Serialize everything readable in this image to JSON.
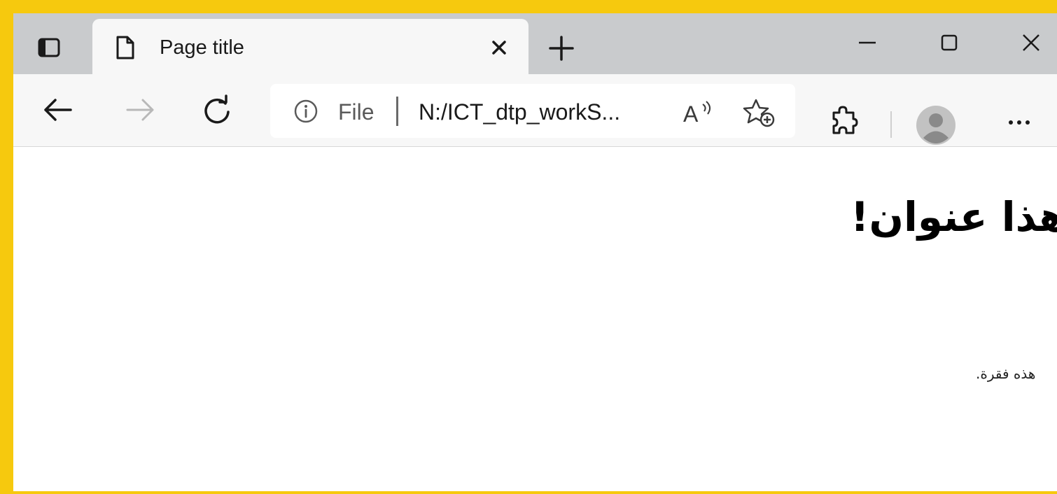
{
  "tab": {
    "title": "Page title"
  },
  "address_bar": {
    "site_label": "File",
    "url": "N:/ICT_dtp_workS..."
  },
  "page": {
    "heading": "هذا عنوان!",
    "paragraph": "هذه فقرة."
  },
  "icons": {
    "tab_actions": "tab-actions-icon",
    "favicon": "page-icon",
    "tab_close": "close-icon",
    "new_tab": "plus-icon",
    "minimize": "minimize-icon",
    "maximize": "maximize-icon",
    "close": "close-icon",
    "back": "arrow-left-icon",
    "forward": "arrow-right-icon",
    "refresh": "refresh-icon",
    "info": "info-icon",
    "read_aloud": "read-aloud-icon",
    "add_favorite": "star-add-icon",
    "extensions": "puzzle-icon",
    "profile": "avatar-icon",
    "more": "more-icon"
  },
  "colors": {
    "frame": "#f6c90e",
    "tabstrip": "#c9cbcd",
    "toolbar": "#f7f7f7"
  }
}
